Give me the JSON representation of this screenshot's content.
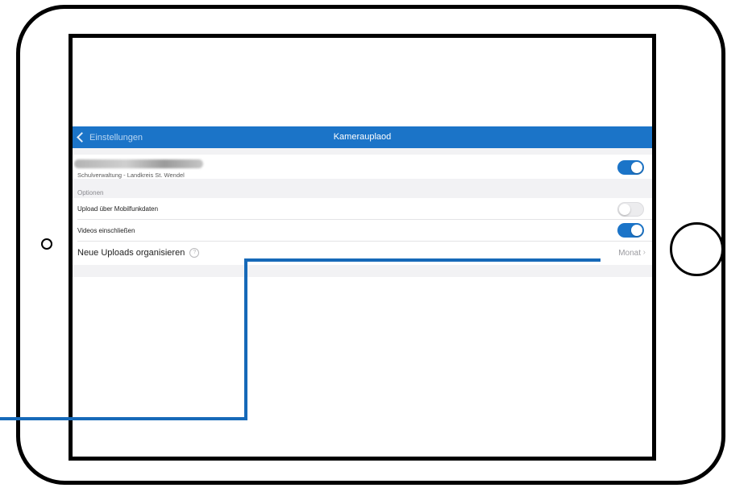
{
  "nav": {
    "back_label": "Einstellungen",
    "title": "Kamerauplaod"
  },
  "account": {
    "subtitle": "Schulverwaltung - Landkreis St. Wendel",
    "enabled": true
  },
  "options": {
    "header": "Optionen",
    "mobile_upload_label": "Upload über Mobilfunkdaten",
    "mobile_upload_enabled": false,
    "videos_label": "Videos einschließen",
    "videos_enabled": true,
    "organize_label": "Neue Uploads organisieren",
    "organize_help_glyph": "?",
    "organize_value": "Monat",
    "organize_chevron": "›"
  },
  "colors": {
    "accent": "#1b74c8",
    "annotation": "#1669b8"
  }
}
